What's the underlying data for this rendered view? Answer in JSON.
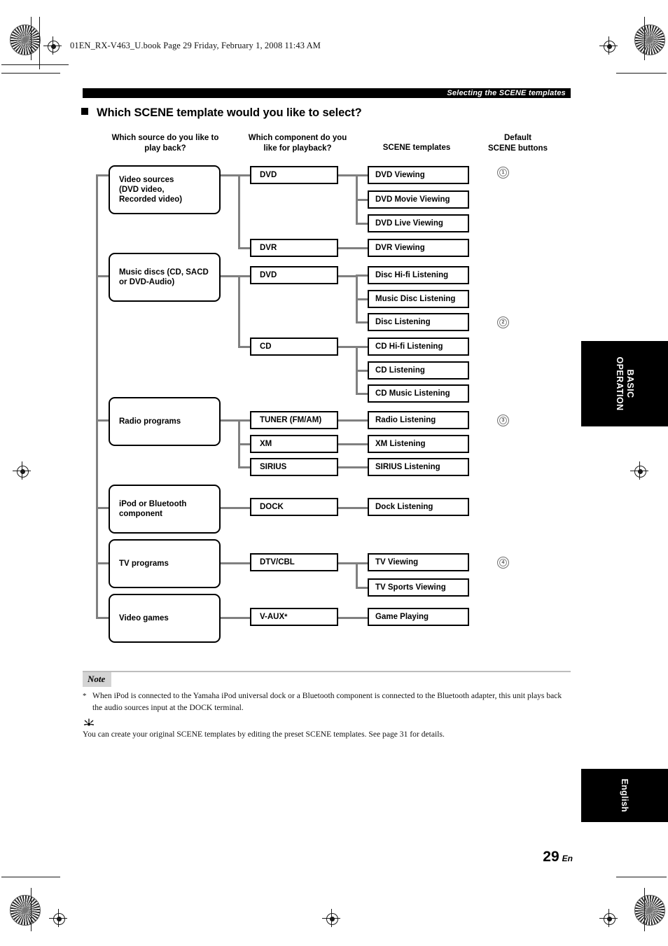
{
  "document": {
    "file_header": "01EN_RX-V463_U.book  Page 29  Friday, February 1, 2008  11:43 AM",
    "running_head": "Selecting the SCENE templates",
    "section_title": "Which SCENE template would you like to select?",
    "page_number": "29",
    "page_lang_suffix": "En"
  },
  "columns": {
    "source": "Which source do you like to\nplay back?",
    "source_line1": "Which source do you like to",
    "source_line2": "play back?",
    "component_line1": "Which component do you",
    "component_line2": "like for playback?",
    "templates": "SCENE templates",
    "buttons_line1": "Default",
    "buttons_line2": "SCENE buttons"
  },
  "sources": [
    {
      "id": "video-sources",
      "label": "Video sources\n(DVD video,\nRecorded video)"
    },
    {
      "id": "music-discs",
      "label": "Music discs (CD, SACD\nor DVD-Audio)"
    },
    {
      "id": "radio-programs",
      "label": "Radio programs"
    },
    {
      "id": "ipod-bluetooth",
      "label": "iPod or Bluetooth\ncomponent"
    },
    {
      "id": "tv-programs",
      "label": "TV programs"
    },
    {
      "id": "video-games",
      "label": "Video games"
    }
  ],
  "components": [
    {
      "id": "dvd-video",
      "label": "DVD",
      "asterisk": ""
    },
    {
      "id": "dvr",
      "label": "DVR",
      "asterisk": ""
    },
    {
      "id": "dvd-audio",
      "label": "DVD",
      "asterisk": ""
    },
    {
      "id": "cd",
      "label": "CD",
      "asterisk": ""
    },
    {
      "id": "tuner",
      "label": "TUNER (FM/AM)",
      "asterisk": ""
    },
    {
      "id": "xm",
      "label": "XM",
      "asterisk": ""
    },
    {
      "id": "sirius",
      "label": "SIRIUS",
      "asterisk": ""
    },
    {
      "id": "dock",
      "label": "DOCK",
      "asterisk": ""
    },
    {
      "id": "dtv-cbl",
      "label": "DTV/CBL",
      "asterisk": ""
    },
    {
      "id": "v-aux",
      "label": "V-AUX",
      "asterisk": "*"
    }
  ],
  "templates": [
    {
      "id": "dvd-viewing",
      "label": "DVD Viewing"
    },
    {
      "id": "dvd-movie-viewing",
      "label": "DVD Movie Viewing"
    },
    {
      "id": "dvd-live-viewing",
      "label": "DVD Live Viewing"
    },
    {
      "id": "dvr-viewing",
      "label": "DVR Viewing"
    },
    {
      "id": "disc-hifi-listening",
      "label": "Disc Hi-fi Listening"
    },
    {
      "id": "music-disc-listening",
      "label": "Music Disc Listening"
    },
    {
      "id": "disc-listening",
      "label": "Disc Listening"
    },
    {
      "id": "cd-hifi-listening",
      "label": "CD Hi-fi Listening"
    },
    {
      "id": "cd-listening",
      "label": "CD Listening"
    },
    {
      "id": "cd-music-listening",
      "label": "CD Music Listening"
    },
    {
      "id": "radio-listening",
      "label": "Radio Listening"
    },
    {
      "id": "xm-listening",
      "label": "XM Listening"
    },
    {
      "id": "sirius-listening",
      "label": "SIRIUS Listening"
    },
    {
      "id": "dock-listening",
      "label": "Dock Listening"
    },
    {
      "id": "tv-viewing",
      "label": "TV Viewing"
    },
    {
      "id": "tv-sports-viewing",
      "label": "TV Sports Viewing"
    },
    {
      "id": "game-playing",
      "label": "Game Playing"
    }
  ],
  "scene_buttons": [
    {
      "id": "scene-1",
      "number": "1",
      "aligned_template": "DVD Viewing"
    },
    {
      "id": "scene-2",
      "number": "2",
      "aligned_template": "Disc Listening"
    },
    {
      "id": "scene-3",
      "number": "3",
      "aligned_template": "Radio Listening"
    },
    {
      "id": "scene-4",
      "number": "4",
      "aligned_template": "TV Viewing"
    }
  ],
  "note": {
    "tag": "Note",
    "marker": "*",
    "text": "When iPod is connected to the Yamaha iPod universal dock or a Bluetooth component is connected to the Bluetooth adapter, this unit plays back the audio sources input at the DOCK terminal.",
    "tip_text": "You can create your original SCENE templates by editing the preset SCENE templates. See page 31 for details."
  },
  "side_tabs": {
    "basic_operation": "BASIC\nOPERATION",
    "basic_operation_line1": "BASIC",
    "basic_operation_line2": "OPERATION",
    "language": "English"
  },
  "colors": {
    "ink": "#000000",
    "connector": "#808080",
    "note_tag_bg": "#d4d4d4",
    "tab_bg": "#000000"
  }
}
